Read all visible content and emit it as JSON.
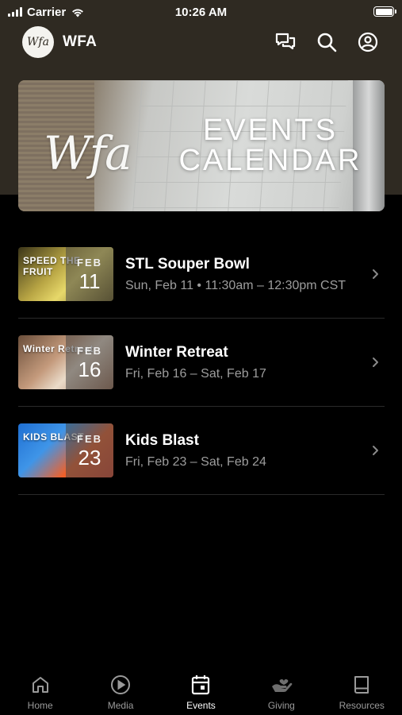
{
  "status_bar": {
    "carrier": "Carrier",
    "time": "10:26 AM"
  },
  "header": {
    "logo_text": "Wfa",
    "title": "WFA",
    "icons": [
      "chat-icon",
      "search-icon",
      "account-icon"
    ]
  },
  "banner": {
    "script_text": "Wfa",
    "title_line1": "EVENTS",
    "title_line2": "CALENDAR"
  },
  "events": [
    {
      "title": "STL Souper Bowl",
      "date": "Sun, Feb 11 • 11:30am – 12:30pm CST",
      "month": "FEB",
      "day": "11",
      "thumb_text": "SPEED THE FRUIT"
    },
    {
      "title": "Winter Retreat",
      "date": "Fri, Feb 16 – Sat, Feb 17",
      "month": "FEB",
      "day": "16",
      "thumb_text": "Winter Retreat"
    },
    {
      "title": "Kids Blast",
      "date": "Fri, Feb 23 – Sat, Feb 24",
      "month": "FEB",
      "day": "23",
      "thumb_text": "KIDS BLAST"
    }
  ],
  "tabs": [
    {
      "label": "Home",
      "icon": "home-icon",
      "active": false
    },
    {
      "label": "Media",
      "icon": "play-icon",
      "active": false
    },
    {
      "label": "Events",
      "icon": "calendar-icon",
      "active": true
    },
    {
      "label": "Giving",
      "icon": "giving-hand-icon",
      "active": false
    },
    {
      "label": "Resources",
      "icon": "book-icon",
      "active": false
    }
  ],
  "colors": {
    "header_background": "#2f2a22",
    "page_background": "#000000",
    "secondary_text": "#9d9d9d",
    "inactive_tab": "#9a9a9a"
  }
}
